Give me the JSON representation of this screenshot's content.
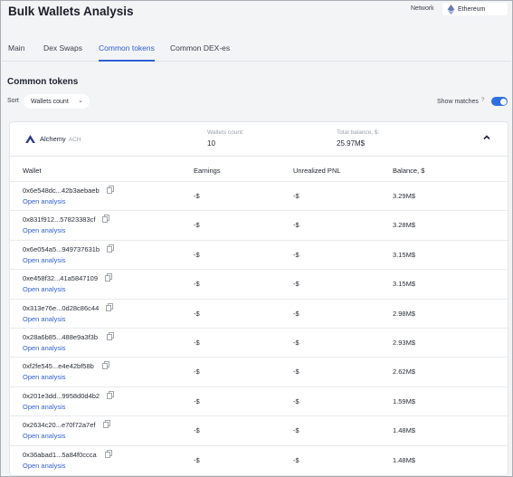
{
  "header": {
    "title": "Bulk Wallets Analysis"
  },
  "network": {
    "label": "Network",
    "value": "Ethereum"
  },
  "tabs": [
    {
      "label": "Main"
    },
    {
      "label": "Dex Swaps"
    },
    {
      "label": "Common tokens",
      "active": true
    },
    {
      "label": "Common DEX-es"
    }
  ],
  "section": {
    "title": "Common tokens"
  },
  "sort": {
    "label": "Sort",
    "value": "Wallets count"
  },
  "show_matches": {
    "label": "Show matches",
    "enabled": true
  },
  "colors": {
    "accent": "#2f5fd6",
    "toggle": "#2f6fe0",
    "logo": "#2a3a8f"
  },
  "token": {
    "name": "Alchemy",
    "symbol": "ACH",
    "wallets_count_label": "Wallets count:",
    "wallets_count": "10",
    "total_balance_label": "Total balance, $:",
    "total_balance": "25.97M$"
  },
  "table": {
    "columns": [
      "Wallet",
      "Earnings",
      "Unrealized PNL",
      "Balance, $"
    ],
    "open_label": "Open analysis",
    "rows": [
      {
        "wallet": "0x6e548dc...42b3aebaeb",
        "earnings": "-$",
        "pnl": "-$",
        "balance": "3.29M$"
      },
      {
        "wallet": "0x831f912...57823383cf",
        "earnings": "-$",
        "pnl": "-$",
        "balance": "3.28M$"
      },
      {
        "wallet": "0x6e054a5...949737631b",
        "earnings": "-$",
        "pnl": "-$",
        "balance": "3.15M$"
      },
      {
        "wallet": "0xe458f32...41a5847109",
        "earnings": "-$",
        "pnl": "-$",
        "balance": "3.15M$"
      },
      {
        "wallet": "0x313e76e...0d28c86c44",
        "earnings": "-$",
        "pnl": "-$",
        "balance": "2.98M$"
      },
      {
        "wallet": "0x28a6b85...488e9a3f3b",
        "earnings": "-$",
        "pnl": "-$",
        "balance": "2.93M$"
      },
      {
        "wallet": "0xf2fe545...e4e42bf58b",
        "earnings": "-$",
        "pnl": "-$",
        "balance": "2.62M$"
      },
      {
        "wallet": "0x201e3dd...9958d0d4b2",
        "earnings": "-$",
        "pnl": "-$",
        "balance": "1.59M$"
      },
      {
        "wallet": "0x2634c20...e70f72a7ef",
        "earnings": "-$",
        "pnl": "-$",
        "balance": "1.48M$"
      },
      {
        "wallet": "0x36abad1...5a84f0ccca",
        "earnings": "-$",
        "pnl": "-$",
        "balance": "1.48M$"
      }
    ]
  }
}
